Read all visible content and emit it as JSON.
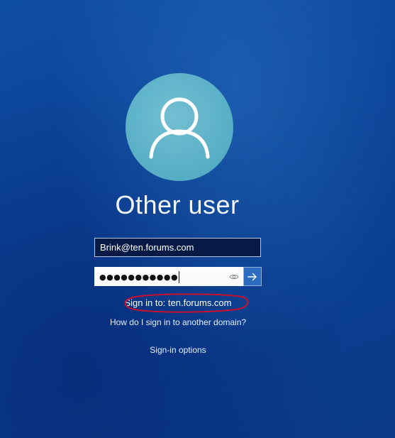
{
  "lock_screen": {
    "avatar_icon": "user-silhouette-icon",
    "user_name": "Other user",
    "username_field": {
      "value": "Brink@ten.forums.com"
    },
    "password_field": {
      "masked_value": "●●●●●●●●●●●",
      "reveal_icon": "eye-icon"
    },
    "submit_icon": "arrow-right-icon",
    "sign_in_domain": "Sign in to: ten.forums.com",
    "other_domain_link": "How do I sign in to another domain?",
    "signin_options_link": "Sign-in options"
  },
  "annotation": {
    "shape": "hand-drawn-ellipse",
    "color": "#c8102e"
  },
  "colors": {
    "background": "#0b4296",
    "avatar": "#5ab0c7",
    "submit_button": "#2c6cc0",
    "username_field_bg": "#071a46"
  }
}
